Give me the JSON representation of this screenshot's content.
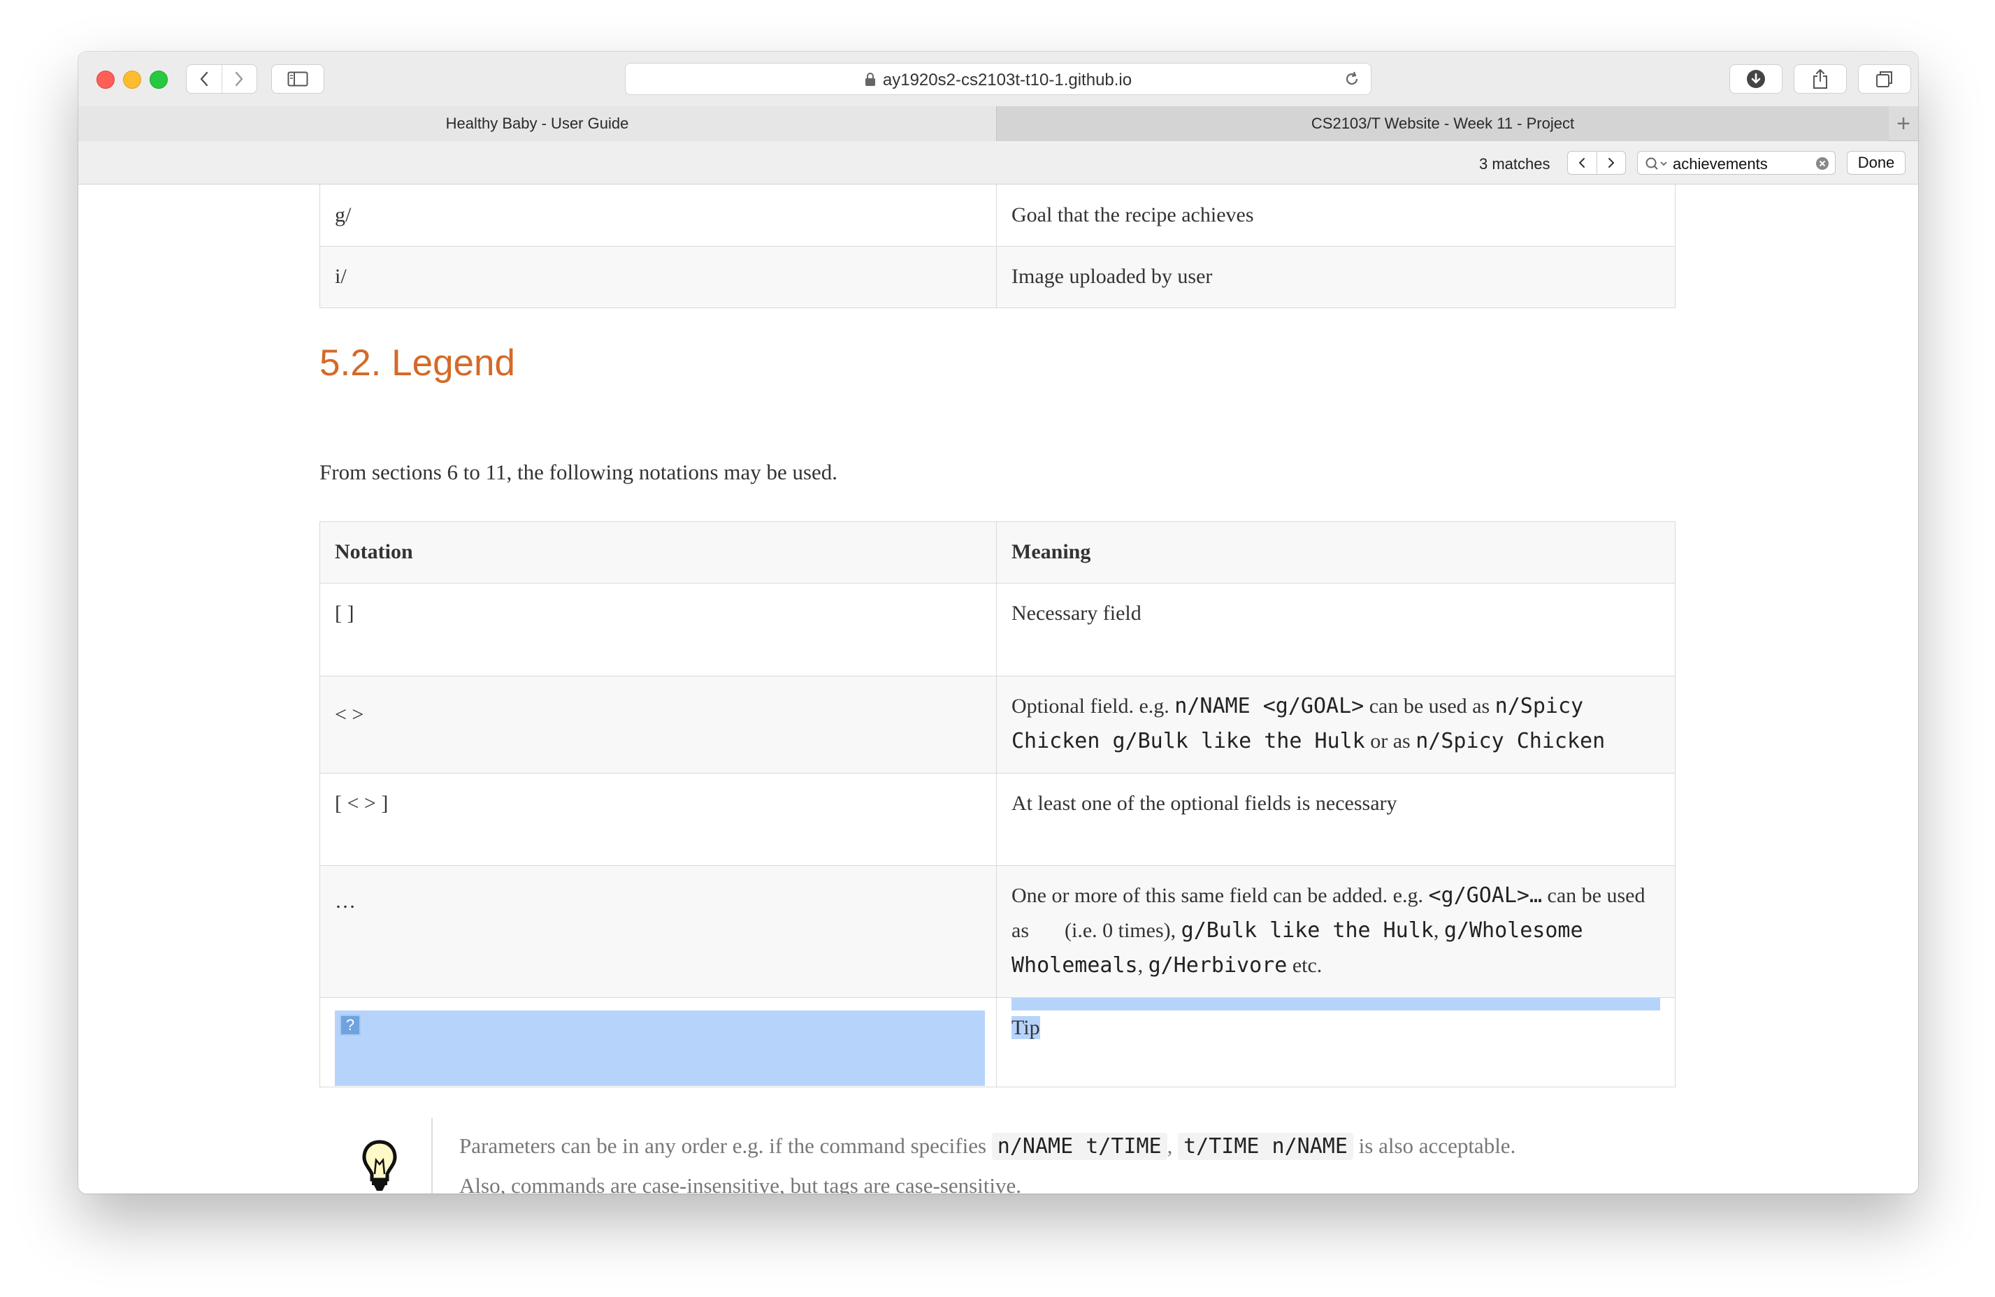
{
  "browser": {
    "url": "ay1920s2-cs2103t-t10-1.github.io",
    "tabs": [
      {
        "label": "Healthy Baby - User Guide"
      },
      {
        "label": "CS2103/T Website - Week 11 - Project"
      }
    ],
    "new_tab": "+"
  },
  "findbar": {
    "matches": "3 matches",
    "query": "achievements",
    "prev": "<",
    "next": ">",
    "done": "Done"
  },
  "top_table": {
    "rows": [
      {
        "notation": "g/",
        "meaning": "Goal that the recipe achieves"
      },
      {
        "notation": "i/",
        "meaning": "Image uploaded by user"
      }
    ]
  },
  "legend": {
    "heading": "5.2. Legend",
    "intro": "From sections 6 to 11, the following notations may be used.",
    "headers": {
      "notation": "Notation",
      "meaning": "Meaning"
    },
    "rows": {
      "r0": {
        "notation": "[ ]",
        "meaning": "Necessary field"
      },
      "r1": {
        "notation": "< >",
        "t1": "Optional field. e.g.",
        "c1": "n/NAME <g/GOAL>",
        "t2": "can be used as",
        "c2": "n/Spicy Chicken g/Bulk like the Hulk",
        "t3": "or as",
        "c3": "n/Spicy Chicken"
      },
      "r2": {
        "notation": "[ < > ]",
        "meaning": "At least one of the optional fields is necessary"
      },
      "r3": {
        "notation": "…",
        "t1": "One or more of this same field can be added. e.g.",
        "c1": "<g/GOAL>…",
        "t2": "can be used as",
        "t3": "(i.e. 0 times),",
        "c2": "g/Bulk like the Hulk",
        "sep": ",",
        "c3": "g/Wholesome Wholemeals",
        "sep2": ",",
        "c4": "g/Herbivore",
        "t4": "etc."
      },
      "r4": {
        "notation_icon": "?",
        "meaning": "Tip"
      }
    }
  },
  "tip": {
    "icon": "lightbulb-icon",
    "t1": "Parameters can be in any order e.g. if the command specifies",
    "c1": "n/NAME t/TIME",
    "sep": ",",
    "c2": "t/TIME n/NAME",
    "t2": "is also acceptable.",
    "line2": "Also, commands are case-insensitive, but tags are case-sensitive."
  },
  "colors": {
    "heading": "#d46a27",
    "selection": "#b6d4fb"
  }
}
